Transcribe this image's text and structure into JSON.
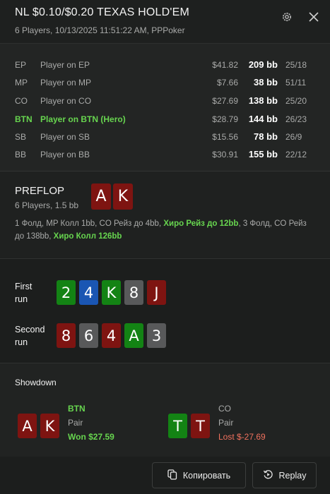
{
  "header": {
    "title": "NL $0.10/$0.20 TEXAS HOLD'EM",
    "subtitle": "6 Players, 10/13/2025 11:51:22 AM, PPPoker",
    "icons": [
      "gear-icon",
      "close-icon"
    ]
  },
  "players": [
    {
      "pos": "EP",
      "name": "Player on EP",
      "amount": "$41.82",
      "bb": "209 bb",
      "ratio": "25/18",
      "hero": false
    },
    {
      "pos": "MP",
      "name": "Player on MP",
      "amount": "$7.66",
      "bb": "38 bb",
      "ratio": "51/11",
      "hero": false
    },
    {
      "pos": "CO",
      "name": "Player on CO",
      "amount": "$27.69",
      "bb": "138 bb",
      "ratio": "25/20",
      "hero": false
    },
    {
      "pos": "BTN",
      "name": "Player on BTN (Hero)",
      "amount": "$28.79",
      "bb": "144 bb",
      "ratio": "26/23",
      "hero": true
    },
    {
      "pos": "SB",
      "name": "Player on SB",
      "amount": "$15.56",
      "bb": "78 bb",
      "ratio": "26/9",
      "hero": false
    },
    {
      "pos": "BB",
      "name": "Player on BB",
      "amount": "$30.91",
      "bb": "155 bb",
      "ratio": "22/12",
      "hero": false
    }
  ],
  "preflop": {
    "title": "PREFLOP",
    "subtitle": "6 Players, 1.5 bb",
    "hero_cards": [
      {
        "rank": "A",
        "color": "#7e1411"
      },
      {
        "rank": "K",
        "color": "#7e1411"
      }
    ],
    "actions_plain_1": "1 Фолд, MP Колл 1bb, CO Рейз до 4bb, ",
    "actions_hl_1": "Хиро Рейз до 12bb",
    "actions_plain_2": ", 3 Фолд, CO Рейз до 138bb, ",
    "actions_hl_2": "Хиро Колл 126bb"
  },
  "runs": [
    {
      "label_line1": "First",
      "label_line2": "run",
      "cards": [
        {
          "rank": "2",
          "suit_color": "green"
        },
        {
          "rank": "4",
          "suit_color": "blue"
        },
        {
          "rank": "K",
          "suit_color": "green"
        },
        {
          "rank": "8",
          "suit_color": "grey"
        },
        {
          "rank": "J",
          "suit_color": "red"
        }
      ]
    },
    {
      "label_line1": "Second",
      "label_line2": "run",
      "cards": [
        {
          "rank": "8",
          "suit_color": "red"
        },
        {
          "rank": "6",
          "suit_color": "grey"
        },
        {
          "rank": "4",
          "suit_color": "red"
        },
        {
          "rank": "A",
          "suit_color": "green"
        },
        {
          "rank": "3",
          "suit_color": "grey"
        }
      ]
    }
  ],
  "showdown": {
    "title": "Showdown",
    "players": [
      {
        "cards": [
          {
            "rank": "A",
            "suit_color": "red"
          },
          {
            "rank": "K",
            "suit_color": "red"
          }
        ],
        "pos": "BTN",
        "hand": "Pair",
        "result": "Won $27.59",
        "won": true
      },
      {
        "cards": [
          {
            "rank": "T",
            "suit_color": "green"
          },
          {
            "rank": "T",
            "suit_color": "red"
          }
        ],
        "pos": "CO",
        "hand": "Pair",
        "result": "Lost $-27.69",
        "won": false
      }
    ]
  },
  "footer": {
    "copy_label": "Копировать",
    "replay_label": "Replay",
    "icons": [
      "copy-icon",
      "replay-icon"
    ]
  },
  "colors": {
    "background": "#1c1e1d",
    "hero_green": "#67d54f",
    "loss_red": "#f0715e",
    "card_red": "#7e1411",
    "card_green": "#138314",
    "card_blue": "#1a56b3",
    "card_grey": "#58595a"
  }
}
